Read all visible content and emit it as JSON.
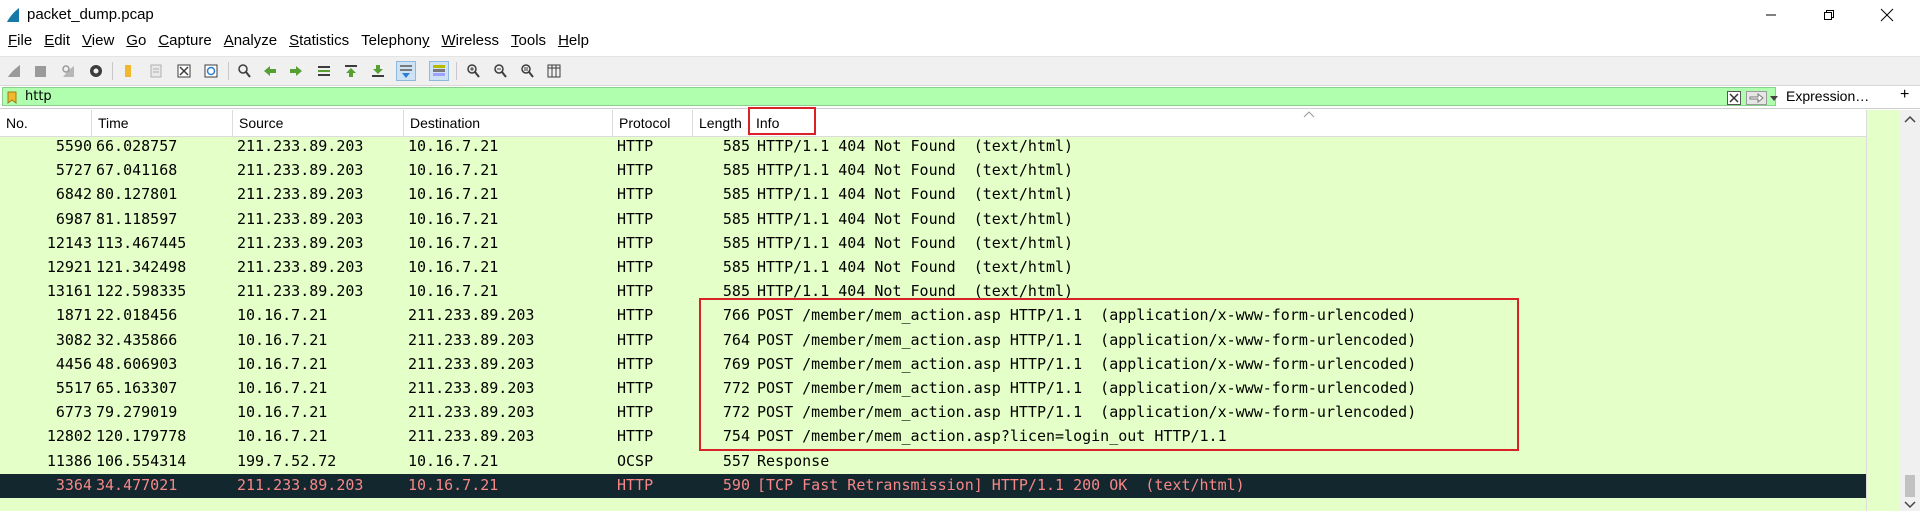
{
  "window": {
    "title": "packet_dump.pcap",
    "icon": "wireshark-fin-icon"
  },
  "menu": [
    {
      "label": "File",
      "accel": "F"
    },
    {
      "label": "Edit",
      "accel": "E"
    },
    {
      "label": "View",
      "accel": "V"
    },
    {
      "label": "Go",
      "accel": "G"
    },
    {
      "label": "Capture",
      "accel": "C"
    },
    {
      "label": "Analyze",
      "accel": "A"
    },
    {
      "label": "Statistics",
      "accel": "S"
    },
    {
      "label": "Telephony",
      "accel": "y"
    },
    {
      "label": "Wireless",
      "accel": "W"
    },
    {
      "label": "Tools",
      "accel": "T"
    },
    {
      "label": "Help",
      "accel": "H"
    }
  ],
  "filter": {
    "value": "http",
    "expression_label": "Expression…",
    "add_label": "+"
  },
  "columns": {
    "no": "No.",
    "time": "Time",
    "source": "Source",
    "destination": "Destination",
    "protocol": "Protocol",
    "length": "Length",
    "info": "Info"
  },
  "colors": {
    "row_bg": "#e4ffc7",
    "filter_bg": "#afffaf",
    "selected_bg": "#12272e",
    "selected_fg": "#f78787",
    "highlight_border": "#d92128"
  },
  "packets": [
    {
      "no": "5590",
      "time": "66.028757",
      "source": "211.233.89.203",
      "destination": "10.16.7.21",
      "protocol": "HTTP",
      "length": "585",
      "info": "HTTP/1.1 404 Not Found  (text/html)",
      "selected": false
    },
    {
      "no": "5727",
      "time": "67.041168",
      "source": "211.233.89.203",
      "destination": "10.16.7.21",
      "protocol": "HTTP",
      "length": "585",
      "info": "HTTP/1.1 404 Not Found  (text/html)",
      "selected": false
    },
    {
      "no": "6842",
      "time": "80.127801",
      "source": "211.233.89.203",
      "destination": "10.16.7.21",
      "protocol": "HTTP",
      "length": "585",
      "info": "HTTP/1.1 404 Not Found  (text/html)",
      "selected": false
    },
    {
      "no": "6987",
      "time": "81.118597",
      "source": "211.233.89.203",
      "destination": "10.16.7.21",
      "protocol": "HTTP",
      "length": "585",
      "info": "HTTP/1.1 404 Not Found  (text/html)",
      "selected": false
    },
    {
      "no": "12143",
      "time": "113.467445",
      "source": "211.233.89.203",
      "destination": "10.16.7.21",
      "protocol": "HTTP",
      "length": "585",
      "info": "HTTP/1.1 404 Not Found  (text/html)",
      "selected": false
    },
    {
      "no": "12921",
      "time": "121.342498",
      "source": "211.233.89.203",
      "destination": "10.16.7.21",
      "protocol": "HTTP",
      "length": "585",
      "info": "HTTP/1.1 404 Not Found  (text/html)",
      "selected": false
    },
    {
      "no": "13161",
      "time": "122.598335",
      "source": "211.233.89.203",
      "destination": "10.16.7.21",
      "protocol": "HTTP",
      "length": "585",
      "info": "HTTP/1.1 404 Not Found  (text/html)",
      "selected": false
    },
    {
      "no": "1871",
      "time": "22.018456",
      "source": "10.16.7.21",
      "destination": "211.233.89.203",
      "protocol": "HTTP",
      "length": "766",
      "info": "POST /member/mem_action.asp HTTP/1.1  (application/x-www-form-urlencoded)",
      "selected": false
    },
    {
      "no": "3082",
      "time": "32.435866",
      "source": "10.16.7.21",
      "destination": "211.233.89.203",
      "protocol": "HTTP",
      "length": "764",
      "info": "POST /member/mem_action.asp HTTP/1.1  (application/x-www-form-urlencoded)",
      "selected": false
    },
    {
      "no": "4456",
      "time": "48.606903",
      "source": "10.16.7.21",
      "destination": "211.233.89.203",
      "protocol": "HTTP",
      "length": "769",
      "info": "POST /member/mem_action.asp HTTP/1.1  (application/x-www-form-urlencoded)",
      "selected": false
    },
    {
      "no": "5517",
      "time": "65.163307",
      "source": "10.16.7.21",
      "destination": "211.233.89.203",
      "protocol": "HTTP",
      "length": "772",
      "info": "POST /member/mem_action.asp HTTP/1.1  (application/x-www-form-urlencoded)",
      "selected": false
    },
    {
      "no": "6773",
      "time": "79.279019",
      "source": "10.16.7.21",
      "destination": "211.233.89.203",
      "protocol": "HTTP",
      "length": "772",
      "info": "POST /member/mem_action.asp HTTP/1.1  (application/x-www-form-urlencoded)",
      "selected": false
    },
    {
      "no": "12802",
      "time": "120.179778",
      "source": "10.16.7.21",
      "destination": "211.233.89.203",
      "protocol": "HTTP",
      "length": "754",
      "info": "POST /member/mem_action.asp?licen=login_out HTTP/1.1",
      "selected": false
    },
    {
      "no": "11386",
      "time": "106.554314",
      "source": "199.7.52.72",
      "destination": "10.16.7.21",
      "protocol": "OCSP",
      "length": "557",
      "info": "Response",
      "selected": false
    },
    {
      "no": "3364",
      "time": "34.477021",
      "source": "211.233.89.203",
      "destination": "10.16.7.21",
      "protocol": "HTTP",
      "length": "590",
      "info": "[TCP Fast Retransmission] HTTP/1.1 200 OK  (text/html)",
      "selected": true
    }
  ]
}
